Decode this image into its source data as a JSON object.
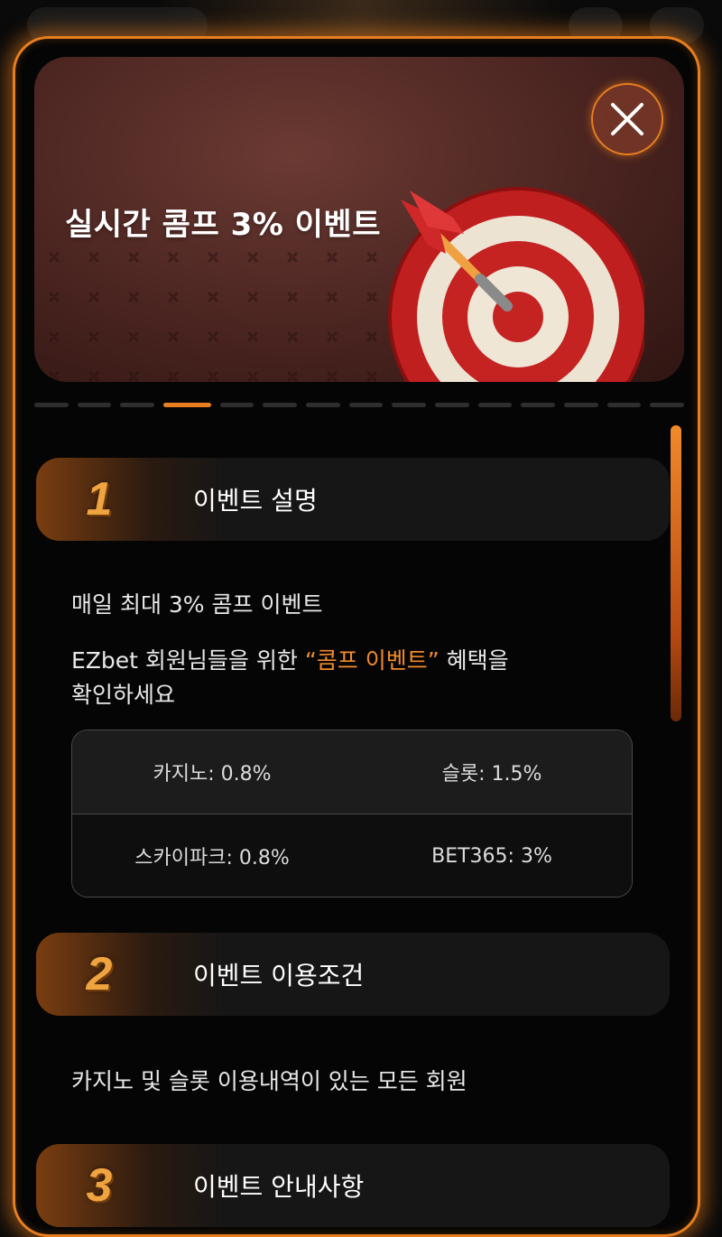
{
  "banner": {
    "title": "실시간 콤프 3% 이벤트",
    "pager": {
      "count": 15,
      "active_index": 3
    }
  },
  "sections": [
    {
      "number": "1",
      "title": "이벤트 설명"
    },
    {
      "number": "2",
      "title": "이벤트 이용조건"
    },
    {
      "number": "3",
      "title": "이벤트 안내사항"
    }
  ],
  "section1": {
    "headline": "매일 최대 3% 콤프 이벤트",
    "desc_prefix": "EZbet 회원님들을 위한 ",
    "desc_highlight": "“콤프 이벤트”",
    "desc_suffix": " 혜택을",
    "desc_line2": "확인하세요",
    "rates": [
      [
        "카지노: 0.8%",
        "슬롯: 1.5%"
      ],
      [
        "스카이파크: 0.8%",
        "BET365: 3%"
      ]
    ]
  },
  "section2": {
    "text": "카지노 및 슬롯 이용내역이 있는 모든 회원"
  },
  "colors": {
    "accent": "#e87e1f",
    "highlight_text": "#f28a2a",
    "background": "#050505"
  },
  "icons": {
    "close": "close-icon",
    "hero": "dartboard-target-icon"
  }
}
